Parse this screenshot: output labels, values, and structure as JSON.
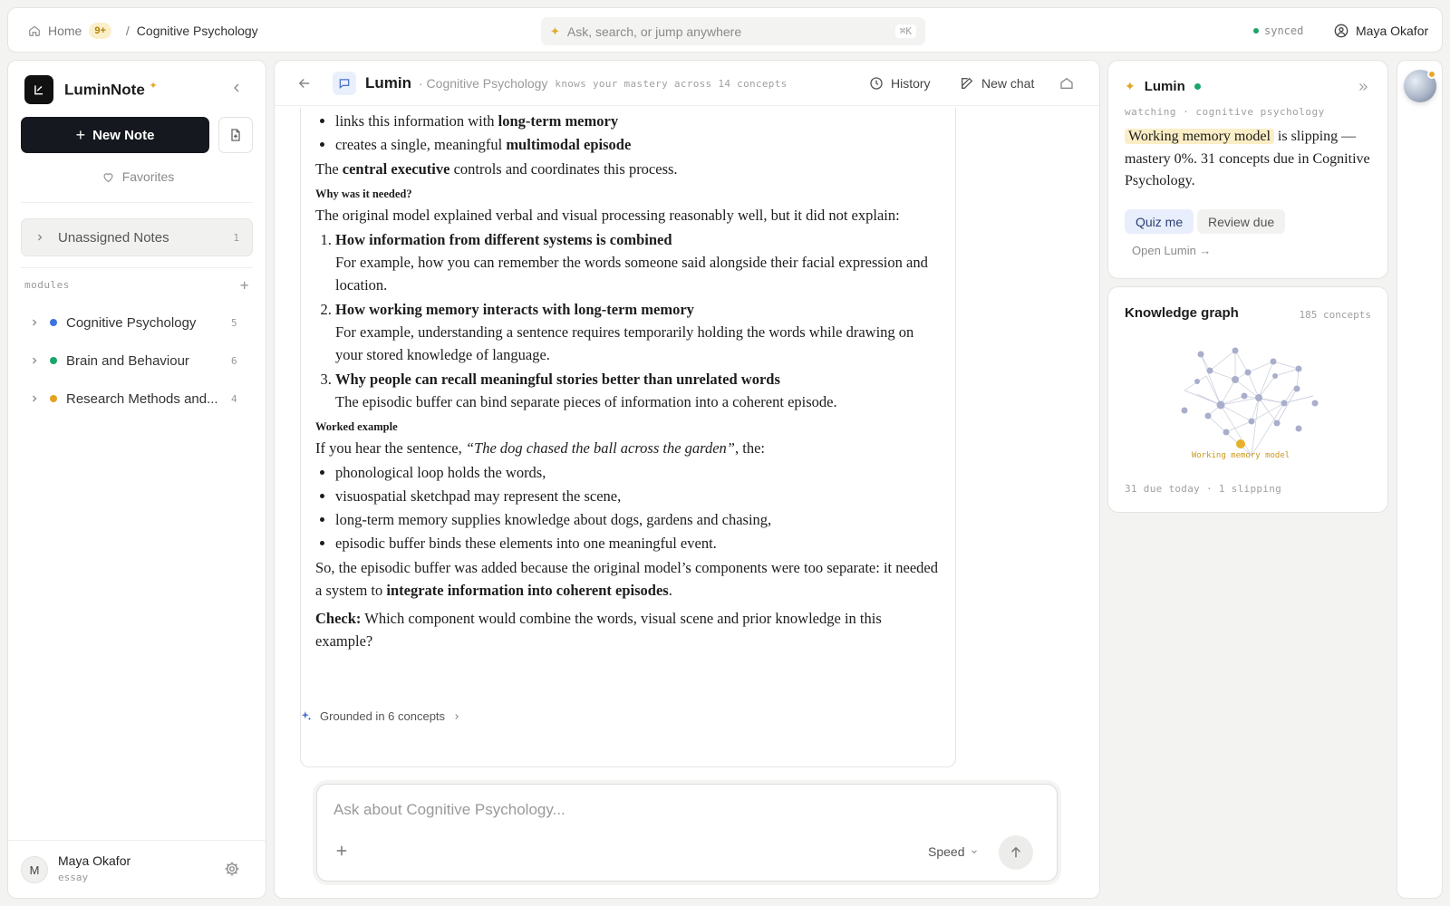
{
  "topbar": {
    "home": "Home",
    "home_badge": "9+",
    "sep": "/",
    "current": "Cognitive Psychology",
    "search_placeholder": "Ask, search, or jump anywhere",
    "search_shortcut": "⌘K",
    "sync_status": "synced",
    "user_name": "Maya Okafor"
  },
  "sidebar": {
    "brand": "LuminNote",
    "new_note": "New Note",
    "favorites": "Favorites",
    "unassigned": {
      "label": "Unassigned Notes",
      "count": "1"
    },
    "modules_label": "modules",
    "modules": [
      {
        "label": "Cognitive Psychology",
        "count": "5",
        "color": "#3b74e0"
      },
      {
        "label": "Brain and Behaviour",
        "count": "6",
        "color": "#1aa56b"
      },
      {
        "label": "Research Methods and...",
        "count": "4",
        "color": "#e5a21f"
      }
    ],
    "footer": {
      "initial": "M",
      "name": "Maya Okafor",
      "sub": "essay"
    }
  },
  "main": {
    "title": "Lumin",
    "subtitle": "· Cognitive Psychology",
    "mastery_note": "knows your mastery across 14 concepts",
    "history": "History",
    "new_chat": "New chat",
    "message": {
      "b1a": "links this information with ",
      "b1b": "long-term memory",
      "b2a": "creates a single, meaningful ",
      "b2b": "multimodal episode",
      "p1a": "The ",
      "p1b": "central executive",
      "p1c": " controls and coordinates this process.",
      "h1": "Why was it needed?",
      "p2": "The original model explained verbal and visual processing reasonably well, but it did not explain:",
      "o1t": "How information from different systems is combined",
      "o1d": "For example, how you can remember the words someone said alongside their facial expression and location.",
      "o2t": "How working memory interacts with long-term memory",
      "o2d": "For example, understanding a sentence requires temporarily holding the words while drawing on your stored knowledge of language.",
      "o3t": "Why people can recall meaningful stories better than unrelated words",
      "o3d": "The episodic buffer can bind separate pieces of information into a coherent episode.",
      "h2": "Worked example",
      "p3a": "If you hear the sentence, ",
      "p3b": "“The dog chased the ball across the garden”",
      "p3c": ", the:",
      "w1": "phonological loop holds the words,",
      "w2": "visuospatial sketchpad may represent the scene,",
      "w3": "long-term memory supplies knowledge about dogs, gardens and chasing,",
      "w4": "episodic buffer binds these elements into one meaningful event.",
      "p4a": "So, the episodic buffer was added because the original model’s components were too separate: it needed a system to ",
      "p4b": "integrate information into coherent episodes",
      "p4c": ".",
      "p5a": "Check:",
      "p5b": " Which component would combine the words, visual scene and prior knowledge in this example?"
    },
    "grounded": "Grounded in 6 concepts",
    "composer_placeholder": "Ask about Cognitive Psychology...",
    "speed": "Speed"
  },
  "lumin_card": {
    "title": "Lumin",
    "watching": "watching · cognitive psychology",
    "highlight": "Working memory model",
    "text": " is slipping — mastery 0%. 31 concepts due in Cognitive Psychology.",
    "quiz": "Quiz me",
    "review": "Review due",
    "open": "Open Lumin →"
  },
  "knowledge_graph": {
    "title": "Knowledge graph",
    "count": "185 concepts",
    "focus_label": "Working memory model",
    "footer": "31 due today · 1 slipping"
  },
  "colors": {
    "accent_gold": "#e4a82a",
    "status_green": "#1aa56b",
    "dark_button": "#16181f"
  }
}
